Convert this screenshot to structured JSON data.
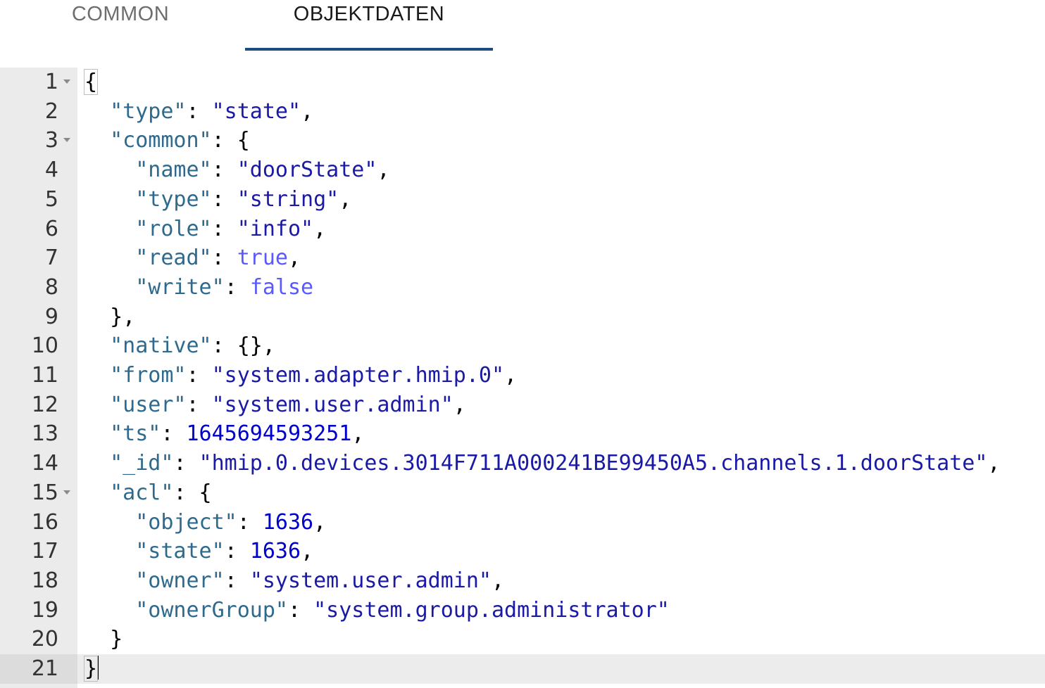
{
  "tabs": [
    {
      "label": "COMMON",
      "active": false
    },
    {
      "label": "OBJEKTDATEN",
      "active": true
    }
  ],
  "colors": {
    "tab_indicator": "#1d4c82",
    "json_key": "#2e6a8e",
    "json_string": "#1a1aa6",
    "json_number": "#0000cd",
    "json_boolean": "#5959ff",
    "gutter_bg": "#ebebeb"
  },
  "editor": {
    "active_line": 21,
    "foldable_lines": [
      1,
      3,
      15
    ],
    "lines": [
      [
        {
          "t": "p",
          "v": "{"
        }
      ],
      [
        {
          "t": "p",
          "v": "  "
        },
        {
          "t": "k",
          "v": "\"type\""
        },
        {
          "t": "p",
          "v": ": "
        },
        {
          "t": "s",
          "v": "\"state\""
        },
        {
          "t": "p",
          "v": ","
        }
      ],
      [
        {
          "t": "p",
          "v": "  "
        },
        {
          "t": "k",
          "v": "\"common\""
        },
        {
          "t": "p",
          "v": ": {"
        }
      ],
      [
        {
          "t": "p",
          "v": "    "
        },
        {
          "t": "k",
          "v": "\"name\""
        },
        {
          "t": "p",
          "v": ": "
        },
        {
          "t": "s",
          "v": "\"doorState\""
        },
        {
          "t": "p",
          "v": ","
        }
      ],
      [
        {
          "t": "p",
          "v": "    "
        },
        {
          "t": "k",
          "v": "\"type\""
        },
        {
          "t": "p",
          "v": ": "
        },
        {
          "t": "s",
          "v": "\"string\""
        },
        {
          "t": "p",
          "v": ","
        }
      ],
      [
        {
          "t": "p",
          "v": "    "
        },
        {
          "t": "k",
          "v": "\"role\""
        },
        {
          "t": "p",
          "v": ": "
        },
        {
          "t": "s",
          "v": "\"info\""
        },
        {
          "t": "p",
          "v": ","
        }
      ],
      [
        {
          "t": "p",
          "v": "    "
        },
        {
          "t": "k",
          "v": "\"read\""
        },
        {
          "t": "p",
          "v": ": "
        },
        {
          "t": "b",
          "v": "true"
        },
        {
          "t": "p",
          "v": ","
        }
      ],
      [
        {
          "t": "p",
          "v": "    "
        },
        {
          "t": "k",
          "v": "\"write\""
        },
        {
          "t": "p",
          "v": ": "
        },
        {
          "t": "b",
          "v": "false"
        }
      ],
      [
        {
          "t": "p",
          "v": "  },"
        }
      ],
      [
        {
          "t": "p",
          "v": "  "
        },
        {
          "t": "k",
          "v": "\"native\""
        },
        {
          "t": "p",
          "v": ": {},"
        }
      ],
      [
        {
          "t": "p",
          "v": "  "
        },
        {
          "t": "k",
          "v": "\"from\""
        },
        {
          "t": "p",
          "v": ": "
        },
        {
          "t": "s",
          "v": "\"system.adapter.hmip.0\""
        },
        {
          "t": "p",
          "v": ","
        }
      ],
      [
        {
          "t": "p",
          "v": "  "
        },
        {
          "t": "k",
          "v": "\"user\""
        },
        {
          "t": "p",
          "v": ": "
        },
        {
          "t": "s",
          "v": "\"system.user.admin\""
        },
        {
          "t": "p",
          "v": ","
        }
      ],
      [
        {
          "t": "p",
          "v": "  "
        },
        {
          "t": "k",
          "v": "\"ts\""
        },
        {
          "t": "p",
          "v": ": "
        },
        {
          "t": "n",
          "v": "1645694593251"
        },
        {
          "t": "p",
          "v": ","
        }
      ],
      [
        {
          "t": "p",
          "v": "  "
        },
        {
          "t": "k",
          "v": "\"_id\""
        },
        {
          "t": "p",
          "v": ": "
        },
        {
          "t": "s",
          "v": "\"hmip.0.devices.3014F711A000241BE99450A5.channels.1.doorState\""
        },
        {
          "t": "p",
          "v": ","
        }
      ],
      [
        {
          "t": "p",
          "v": "  "
        },
        {
          "t": "k",
          "v": "\"acl\""
        },
        {
          "t": "p",
          "v": ": {"
        }
      ],
      [
        {
          "t": "p",
          "v": "    "
        },
        {
          "t": "k",
          "v": "\"object\""
        },
        {
          "t": "p",
          "v": ": "
        },
        {
          "t": "n",
          "v": "1636"
        },
        {
          "t": "p",
          "v": ","
        }
      ],
      [
        {
          "t": "p",
          "v": "    "
        },
        {
          "t": "k",
          "v": "\"state\""
        },
        {
          "t": "p",
          "v": ": "
        },
        {
          "t": "n",
          "v": "1636"
        },
        {
          "t": "p",
          "v": ","
        }
      ],
      [
        {
          "t": "p",
          "v": "    "
        },
        {
          "t": "k",
          "v": "\"owner\""
        },
        {
          "t": "p",
          "v": ": "
        },
        {
          "t": "s",
          "v": "\"system.user.admin\""
        },
        {
          "t": "p",
          "v": ","
        }
      ],
      [
        {
          "t": "p",
          "v": "    "
        },
        {
          "t": "k",
          "v": "\"ownerGroup\""
        },
        {
          "t": "p",
          "v": ": "
        },
        {
          "t": "s",
          "v": "\"system.group.administrator\""
        }
      ],
      [
        {
          "t": "p",
          "v": "  }"
        }
      ],
      [
        {
          "t": "p",
          "v": "}"
        }
      ]
    ]
  }
}
